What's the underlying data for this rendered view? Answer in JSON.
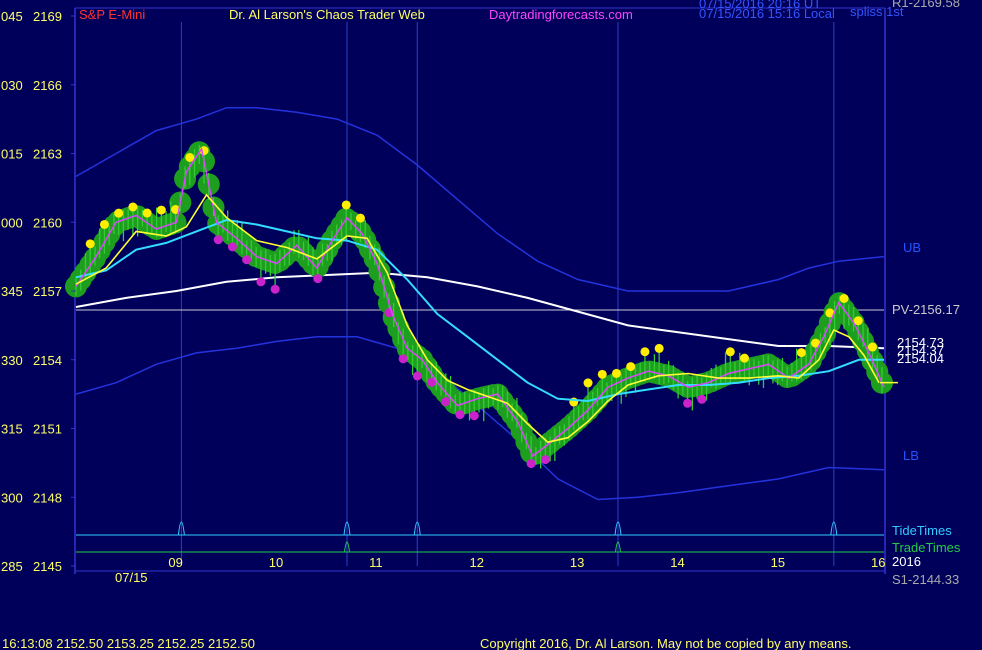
{
  "header": {
    "symbol": "S&P E-Mini",
    "title": "Dr. Al Larson's Chaos Trader Web",
    "site": "Daytradingforecasts.com",
    "stamp_ut": "07/15/2016 20:16 UT",
    "stamp_local": "07/15/2016 15:16 Local",
    "corner_label": "spliss 1st"
  },
  "footer": {
    "quote": "16:13:08  2152.50  2153.25  2152.25  2152.50",
    "copyright": "Copyright 2016, Dr. Al Larson. May not be copied by any means."
  },
  "colors": {
    "background": "#00005a",
    "frame": "#3333cc",
    "price_bars": "#33cc33",
    "green_halo": "#1e9e1e",
    "yellow_dots": "#ffee00",
    "magenta_dots": "#cc22cc",
    "yellow_ma": "#ffff33",
    "magenta_ma": "#dd44ff",
    "cyan_ma": "#33ddff",
    "white_ma": "#ffffff",
    "band": "#2233dd",
    "tide_line": "#33ccff",
    "trade_line": "#22cc44"
  },
  "chart_data": {
    "type": "line",
    "title": "S&P E-Mini",
    "y_axis": {
      "ticks": [
        {
          "left": "045",
          "price": "2169",
          "value": 2169
        },
        {
          "left": "030",
          "price": "2166",
          "value": 2166
        },
        {
          "left": "015",
          "price": "2163",
          "value": 2163
        },
        {
          "left": "000",
          "price": "2160",
          "value": 2160
        },
        {
          "left": "345",
          "price": "2157",
          "value": 2157
        },
        {
          "left": "330",
          "price": "2154",
          "value": 2154
        },
        {
          "left": "315",
          "price": "2151",
          "value": 2151
        },
        {
          "left": "300",
          "price": "2148",
          "value": 2148
        },
        {
          "left": "285",
          "price": "2145",
          "value": 2145
        }
      ],
      "ylim": [
        2145,
        2169
      ]
    },
    "x_axis": {
      "xlim": [
        8.0,
        16.05
      ],
      "ticks": [
        {
          "label": "09",
          "value": 9
        },
        {
          "label": "10",
          "value": 10
        },
        {
          "label": "11",
          "value": 11
        },
        {
          "label": "12",
          "value": 12
        },
        {
          "label": "13",
          "value": 13
        },
        {
          "label": "14",
          "value": 14
        },
        {
          "label": "15",
          "value": 15
        },
        {
          "label": "16",
          "value": 16
        }
      ],
      "date_label": "07/15"
    },
    "right_labels": {
      "r1": "R1-2169.58",
      "ub": "UB",
      "pv": "PV-2156.17",
      "p1": "2154.73",
      "p2": "2154.37",
      "p3": "2154.04",
      "lb": "LB",
      "tide": "TideTimes",
      "trade": "TradeTimes",
      "year": "2016",
      "s1": "S1-2144.33"
    },
    "pivot": 2156.17,
    "vertical_lines": [
      9.05,
      10.7,
      11.4,
      13.4,
      15.55
    ],
    "tide_times": [
      9.05,
      10.7,
      11.4,
      13.4,
      15.55
    ],
    "trade_times": [
      10.7,
      13.4
    ],
    "series": [
      {
        "key": "price",
        "x": [
          8.0,
          8.2,
          8.4,
          8.6,
          8.8,
          9.0,
          9.1,
          9.25,
          9.4,
          9.6,
          9.8,
          10.0,
          10.2,
          10.4,
          10.55,
          10.7,
          10.85,
          11.0,
          11.15,
          11.3,
          11.45,
          11.6,
          11.8,
          12.0,
          12.2,
          12.4,
          12.55,
          12.7,
          12.9,
          13.1,
          13.3,
          13.5,
          13.7,
          13.9,
          14.1,
          14.3,
          14.5,
          14.7,
          14.9,
          15.1,
          15.3,
          15.45,
          15.6,
          15.75,
          15.9,
          16.05
        ],
        "values": [
          2157.2,
          2158.5,
          2160.0,
          2160.3,
          2159.7,
          2160.0,
          2162.2,
          2163.2,
          2160.0,
          2159.3,
          2158.5,
          2158.2,
          2159.0,
          2158.0,
          2159.2,
          2160.2,
          2159.5,
          2158.2,
          2156.0,
          2154.5,
          2154.0,
          2153.0,
          2152.0,
          2152.3,
          2152.5,
          2151.3,
          2149.8,
          2150.3,
          2151.0,
          2151.8,
          2152.8,
          2153.2,
          2153.5,
          2153.3,
          2152.8,
          2153.0,
          2153.4,
          2153.6,
          2153.8,
          2153.2,
          2153.8,
          2155.0,
          2156.5,
          2155.6,
          2154.3,
          2152.8
        ]
      },
      {
        "key": "yellow_ma",
        "x": [
          8.0,
          8.3,
          8.6,
          8.9,
          9.1,
          9.3,
          9.5,
          9.8,
          10.1,
          10.4,
          10.7,
          10.9,
          11.1,
          11.3,
          11.5,
          11.7,
          11.9,
          12.1,
          12.3,
          12.5,
          12.7,
          12.9,
          13.1,
          13.3,
          13.5,
          13.8,
          14.1,
          14.4,
          14.7,
          15.0,
          15.2,
          15.4,
          15.55,
          15.7,
          15.85,
          16.0
        ],
        "values": [
          2157.3,
          2158.0,
          2159.6,
          2159.4,
          2159.8,
          2161.2,
          2160.2,
          2159.2,
          2158.9,
          2158.4,
          2159.4,
          2159.3,
          2157.8,
          2155.5,
          2154.0,
          2153.1,
          2152.7,
          2152.4,
          2152.1,
          2151.2,
          2150.4,
          2150.6,
          2151.3,
          2152.2,
          2152.9,
          2153.3,
          2153.4,
          2153.2,
          2153.2,
          2153.3,
          2153.2,
          2154.0,
          2155.3,
          2155.0,
          2154.2,
          2153.0
        ]
      },
      {
        "key": "cyan_ma",
        "x": [
          8.0,
          8.3,
          8.6,
          8.9,
          9.2,
          9.5,
          9.8,
          10.1,
          10.4,
          10.7,
          11.0,
          11.3,
          11.6,
          11.9,
          12.2,
          12.5,
          12.8,
          13.1,
          13.4,
          13.7,
          14.0,
          14.3,
          14.6,
          14.9,
          15.2,
          15.5,
          15.8,
          16.05
        ],
        "values": [
          2157.6,
          2157.9,
          2158.8,
          2159.1,
          2159.6,
          2160.1,
          2159.9,
          2159.6,
          2159.3,
          2159.2,
          2158.8,
          2157.5,
          2156.0,
          2155.0,
          2154.0,
          2153.0,
          2152.3,
          2152.2,
          2152.5,
          2152.7,
          2152.9,
          2152.9,
          2153.0,
          2153.2,
          2153.3,
          2153.5,
          2154.0,
          2154.0
        ]
      },
      {
        "key": "white_ma",
        "x": [
          8.0,
          8.5,
          9.0,
          9.5,
          10.0,
          10.5,
          11.0,
          11.5,
          12.0,
          12.5,
          13.0,
          13.5,
          14.0,
          14.5,
          15.0,
          15.5,
          16.05
        ],
        "values": [
          2156.3,
          2156.7,
          2157.0,
          2157.4,
          2157.6,
          2157.7,
          2157.8,
          2157.6,
          2157.2,
          2156.7,
          2156.1,
          2155.5,
          2155.2,
          2154.9,
          2154.6,
          2154.6,
          2154.5
        ]
      },
      {
        "key": "upper_band",
        "x": [
          8.0,
          8.4,
          8.8,
          9.2,
          9.5,
          9.8,
          10.2,
          10.6,
          11.0,
          11.4,
          11.8,
          12.2,
          12.6,
          13.0,
          13.5,
          14.0,
          14.5,
          15.0,
          15.3,
          15.6,
          16.05
        ],
        "values": [
          2162.0,
          2163.0,
          2164.0,
          2164.5,
          2165.0,
          2165.0,
          2164.8,
          2164.5,
          2163.8,
          2162.5,
          2161.0,
          2159.5,
          2158.3,
          2157.5,
          2157.0,
          2157.0,
          2157.0,
          2157.5,
          2158.0,
          2158.3,
          2158.5
        ]
      },
      {
        "key": "lower_band",
        "x": [
          8.0,
          8.4,
          8.8,
          9.2,
          9.6,
          10.0,
          10.4,
          10.8,
          11.2,
          11.6,
          12.0,
          12.4,
          12.8,
          13.2,
          13.6,
          14.0,
          14.5,
          15.0,
          15.5,
          16.05
        ],
        "values": [
          2152.5,
          2153.0,
          2153.8,
          2154.3,
          2154.5,
          2154.8,
          2155.0,
          2155.0,
          2154.5,
          2153.5,
          2152.0,
          2150.5,
          2148.8,
          2147.9,
          2148.0,
          2148.2,
          2148.5,
          2148.8,
          2149.3,
          2149.2
        ]
      }
    ]
  }
}
